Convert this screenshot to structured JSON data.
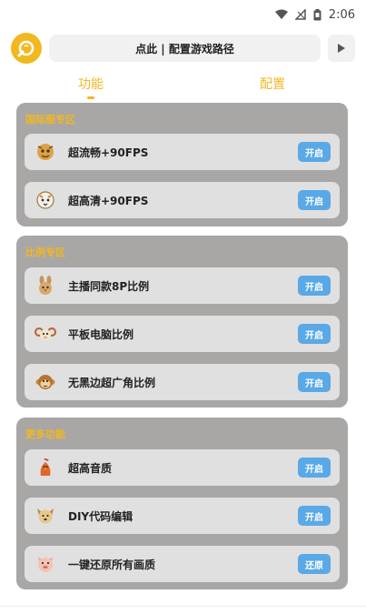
{
  "status_bar": {
    "time": "2:06"
  },
  "header": {
    "path_label": "点此 | 配置游戏路径"
  },
  "tabs": [
    {
      "label": "功能",
      "active": true
    },
    {
      "label": "配置",
      "active": false
    }
  ],
  "colors": {
    "accent": "#f2b820",
    "button": "#5aa9e6",
    "section_bg": "#a9a6a6",
    "row_bg": "#e0e0e0"
  },
  "sections": [
    {
      "title": "国际服专区",
      "items": [
        {
          "label": "超流畅+90FPS",
          "button": "开启",
          "icon": "dragon-icon"
        },
        {
          "label": "超高清+90FPS",
          "button": "开启",
          "icon": "tiger-icon"
        }
      ]
    },
    {
      "title": "比例专区",
      "items": [
        {
          "label": "主播同款8P比例",
          "button": "开启",
          "icon": "rabbit-icon"
        },
        {
          "label": "平板电脑比例",
          "button": "开启",
          "icon": "ram-icon"
        },
        {
          "label": "无黑边超广角比例",
          "button": "开启",
          "icon": "monkey-icon"
        }
      ]
    },
    {
      "title": "更多功能",
      "items": [
        {
          "label": "超高音质",
          "button": "开启",
          "icon": "rooster-icon"
        },
        {
          "label": "DIY代码编辑",
          "button": "开启",
          "icon": "dog-icon"
        },
        {
          "label": "一键还原所有画质",
          "button": "还原",
          "icon": "pig-icon"
        }
      ]
    }
  ]
}
